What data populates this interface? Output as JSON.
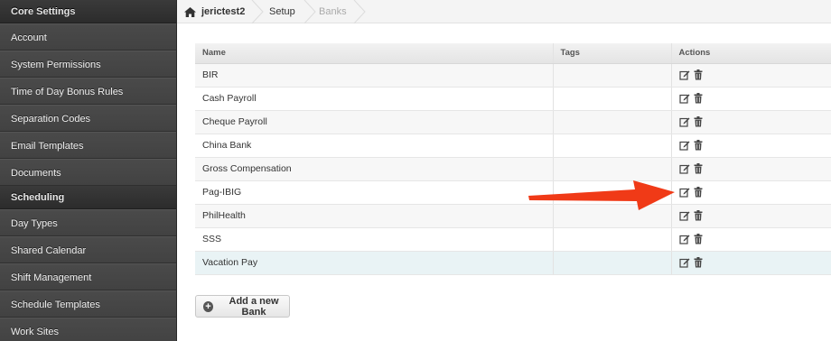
{
  "sidebar": {
    "items": [
      {
        "label": "Core Settings",
        "header": true
      },
      {
        "label": "Account"
      },
      {
        "label": "System Permissions"
      },
      {
        "label": "Time of Day Bonus Rules"
      },
      {
        "label": "Separation Codes"
      },
      {
        "label": "Email Templates"
      },
      {
        "label": "Documents"
      },
      {
        "label": "Scheduling",
        "header": true
      },
      {
        "label": "Day Types"
      },
      {
        "label": "Shared Calendar"
      },
      {
        "label": "Shift Management"
      },
      {
        "label": "Schedule Templates"
      },
      {
        "label": "Work Sites"
      }
    ]
  },
  "breadcrumb": {
    "home": "jerictest2",
    "setup": "Setup",
    "current": "Banks"
  },
  "table": {
    "columns": {
      "name": "Name",
      "tags": "Tags",
      "actions": "Actions"
    },
    "rows": [
      {
        "name": "BIR",
        "tags": ""
      },
      {
        "name": "Cash Payroll",
        "tags": ""
      },
      {
        "name": "Cheque Payroll",
        "tags": ""
      },
      {
        "name": "China Bank",
        "tags": ""
      },
      {
        "name": "Gross Compensation",
        "tags": ""
      },
      {
        "name": "Pag-IBIG",
        "tags": ""
      },
      {
        "name": "PhilHealth",
        "tags": ""
      },
      {
        "name": "SSS",
        "tags": ""
      },
      {
        "name": "Vacation Pay",
        "tags": ""
      }
    ],
    "highlighted_row": "Vacation Pay"
  },
  "add_button": {
    "label": "Add a new Bank",
    "icon": "plus-circle-icon"
  },
  "annotation": {
    "arrow_target_row": "Pag-IBIG",
    "arrow_color": "#f03a17"
  },
  "colors": {
    "sidebar_bg": "#3d3d3d",
    "highlight_row": "#e9f3f5"
  }
}
